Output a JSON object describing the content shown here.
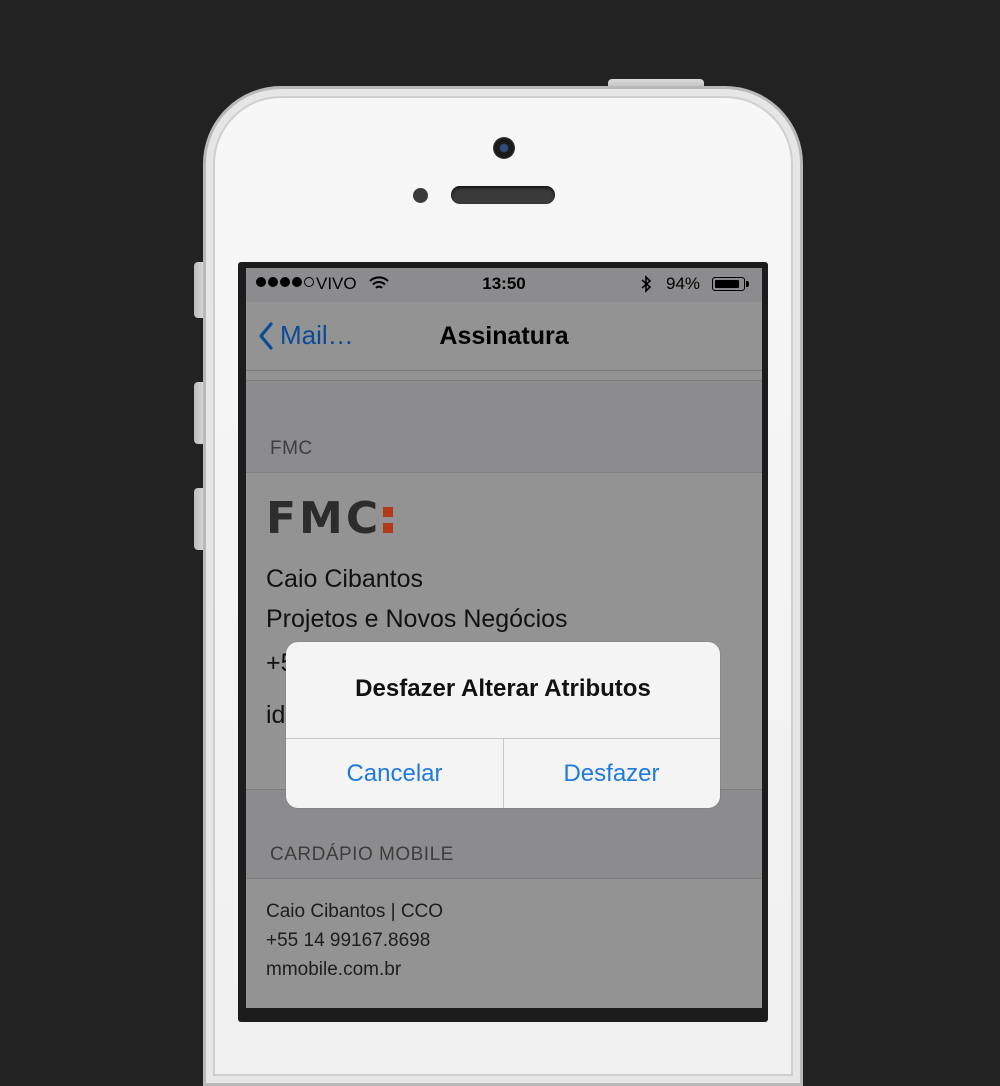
{
  "status_bar": {
    "carrier": "VIVO",
    "time": "13:50",
    "battery_percent_text": "94%",
    "battery_level": 0.94,
    "signal_bars_filled": 4,
    "signal_bars_total": 5
  },
  "navbar": {
    "back_label": "Mail…",
    "title": "Assinatura"
  },
  "sections": {
    "fmc": {
      "header": "FMC",
      "logo_text": "FMC",
      "lines": [
        "Caio Cibantos",
        "Projetos e Novos Negócios",
        "+5",
        "id"
      ]
    },
    "cardapio": {
      "header": "CARDÁPIO MOBILE",
      "lines": [
        "Caio Cibantos | CCO",
        "+55 14 99167.8698",
        "mmobile.com.br"
      ]
    }
  },
  "alert": {
    "title": "Desfazer Alterar Atributos",
    "cancel_label": "Cancelar",
    "confirm_label": "Desfazer"
  },
  "colors": {
    "accent": "#1f7ae0",
    "logo_accent": "#b03a1a",
    "background": "#222222"
  }
}
